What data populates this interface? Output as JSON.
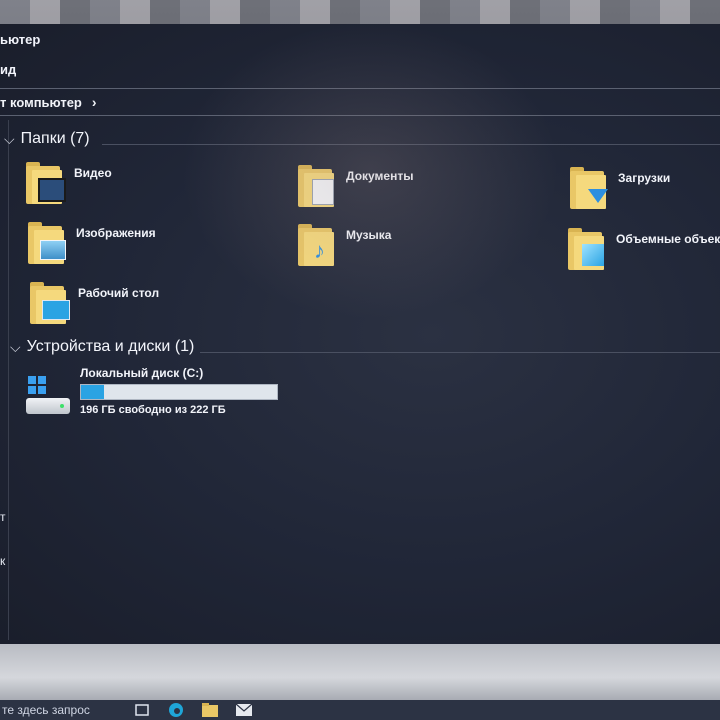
{
  "ribbon": {
    "row1_text": "ьютер",
    "row2_text": "ид"
  },
  "address_bar": {
    "path_text": "т компьютер"
  },
  "folders_group": {
    "title": "Папки (7)",
    "items": [
      {
        "label": "Видео"
      },
      {
        "label": "Документы"
      },
      {
        "label": "Загрузки"
      },
      {
        "label": "Изображения"
      },
      {
        "label": "Музыка"
      },
      {
        "label": "Объемные объек"
      },
      {
        "label": "Рабочий стол"
      }
    ]
  },
  "devices_group": {
    "title": "Устройства и диски (1)",
    "drive": {
      "name": "Локальный диск (C:)",
      "free_text": "196 ГБ свободно из 222 ГБ",
      "used_fraction": 0.1171
    }
  },
  "left_edge": {
    "char1": "т",
    "char2": "к"
  },
  "taskbar": {
    "search_text": "те здесь запрос"
  },
  "colors": {
    "accent_blue": "#2aa3e3",
    "folder_yellow": "#f5d97d"
  }
}
